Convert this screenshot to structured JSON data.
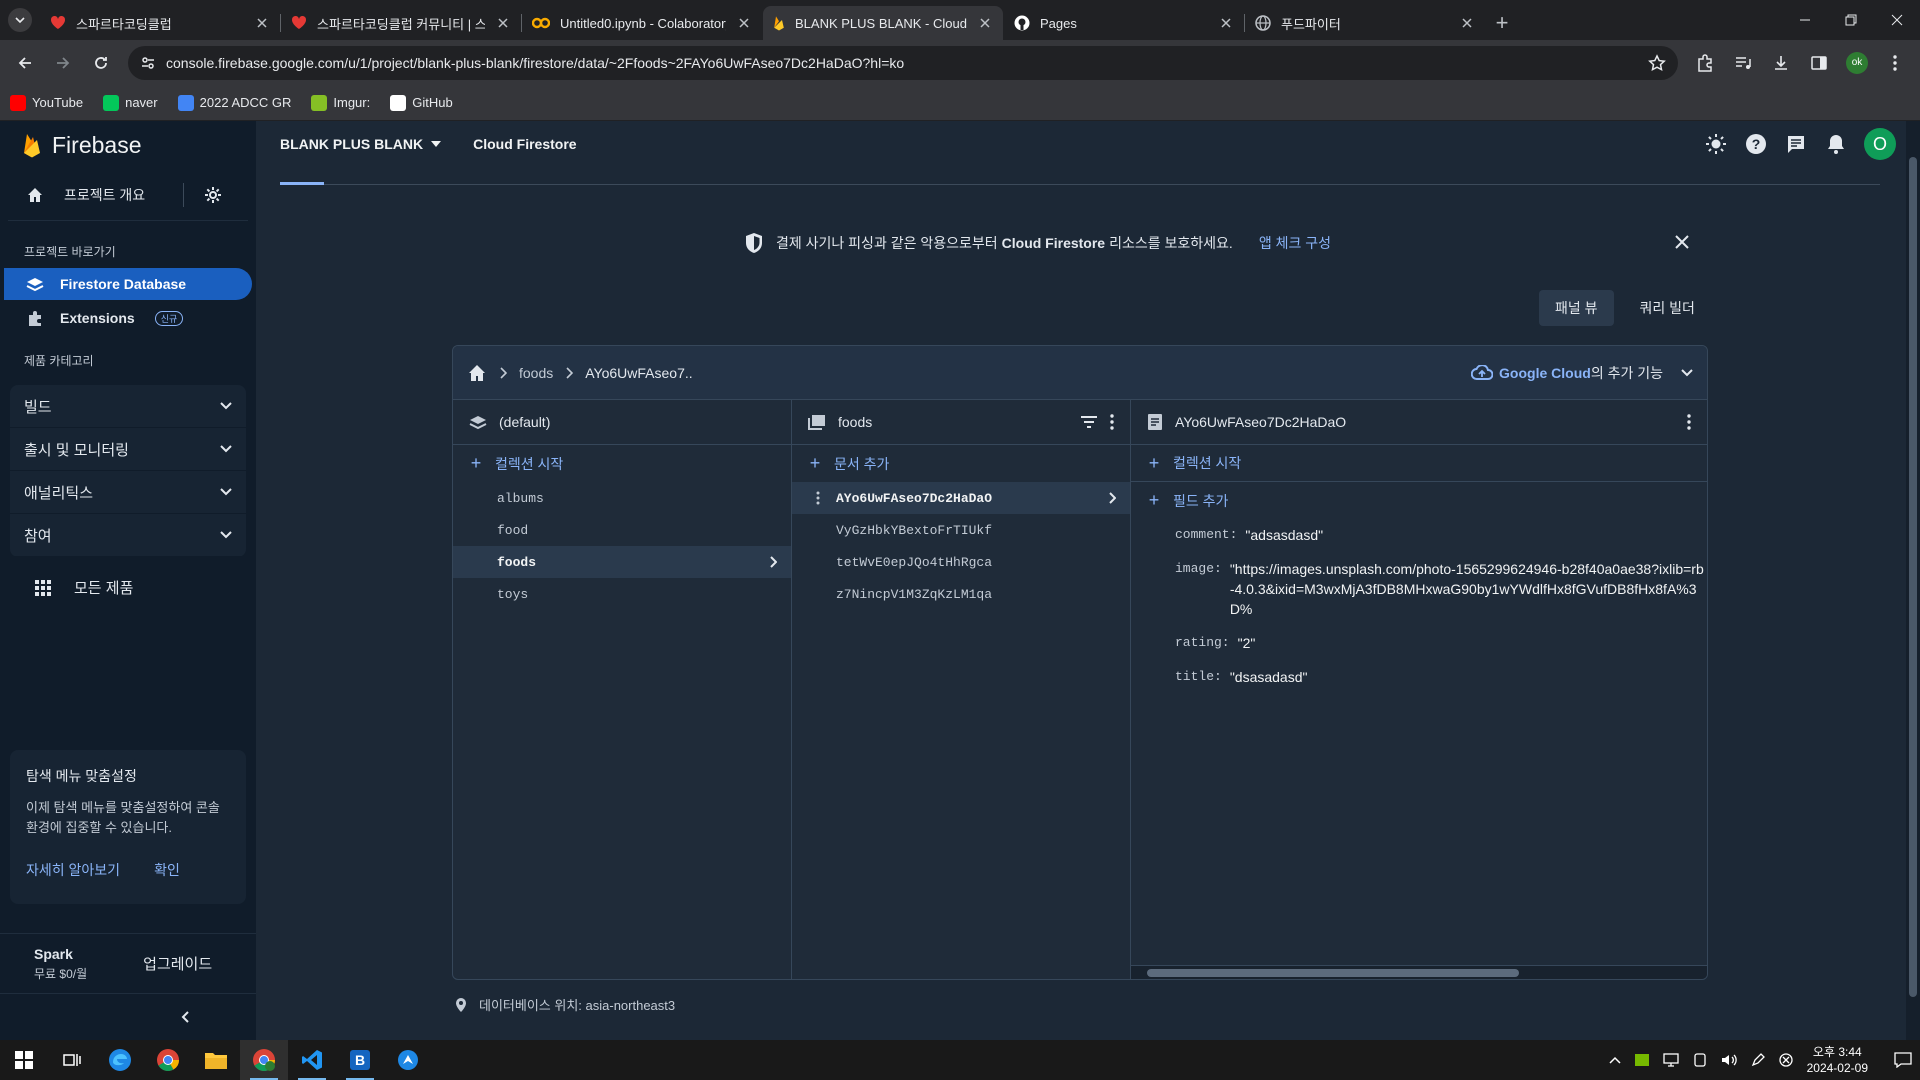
{
  "browser": {
    "tabs": [
      {
        "title": "스파르타코딩클럽",
        "icon": "heart-icon",
        "color": "#e53935"
      },
      {
        "title": "스파르타코딩클럽 커뮤니티 | 스",
        "icon": "heart-icon",
        "color": "#e53935"
      },
      {
        "title": "Untitled0.ipynb - Colaboratory",
        "icon": "colab-icon",
        "color": "#f9ab00"
      },
      {
        "title": "BLANK PLUS BLANK - Cloud Fi",
        "icon": "firebase-icon",
        "color": "#ffca28"
      },
      {
        "title": "Pages",
        "icon": "github-icon",
        "color": "#ffffff"
      },
      {
        "title": "푸드파이터",
        "icon": "globe-icon",
        "color": "#bdc1c6"
      }
    ],
    "active_tab": 3,
    "url": "console.firebase.google.com/u/1/project/blank-plus-blank/firestore/data/~2Ffoods~2FAYo6UwFAseo7Dc2HaDaO?hl=ko",
    "profile_initials": "ok",
    "bookmarks": [
      {
        "label": "YouTube",
        "color": "#ff0000"
      },
      {
        "label": "naver",
        "color": "#03c75a"
      },
      {
        "label": "2022 ADCC GR",
        "color": "#4285f4"
      },
      {
        "label": "Imgur:",
        "color": "#85bf25"
      },
      {
        "label": "GitHub",
        "color": "#ffffff"
      }
    ]
  },
  "firebase": {
    "brand": "Firebase",
    "sidebar": {
      "overview": "프로젝트 개요",
      "shortcuts_label": "프로젝트 바로가기",
      "shortcuts": [
        {
          "label": "Firestore Database",
          "active": true
        },
        {
          "label": "Extensions",
          "badge": "신규",
          "active": false
        }
      ],
      "category_label": "제품 카테고리",
      "categories": [
        "빌드",
        "출시 및 모니터링",
        "애널리틱스",
        "참여"
      ],
      "all_products": "모든 제품",
      "promo": {
        "title": "탐색 메뉴 맞춤설정",
        "body": "이제 탐색 메뉴를 맞춤설정하여 콘솔 환경에 집중할 수 있습니다.",
        "learn_more": "자세히 알아보기",
        "confirm": "확인"
      },
      "plan": {
        "name": "Spark",
        "price": "무료 $0/월",
        "upgrade": "업그레이드"
      }
    },
    "topbar": {
      "project": "BLANK PLUS BLANK",
      "product": "Cloud Firestore",
      "avatar": "O"
    },
    "banner": {
      "text_before": "결제 사기나 피싱과 같은 악용으로부터",
      "text_bold": "Cloud Firestore",
      "text_after": "리소스를 보호하세요.",
      "link": "앱 체크 구성"
    },
    "view_toggle": {
      "panel": "패널 뷰",
      "query": "쿼리 빌더",
      "selected": "panel"
    },
    "breadcrumbs": [
      "foods",
      "AYo6UwFAseo7.."
    ],
    "google_cloud": {
      "bold": "Google Cloud",
      "rest": "의 추가 기능"
    },
    "columns": {
      "root": {
        "title": "(default)",
        "add_label": "컬렉션 시작",
        "items": [
          "albums",
          "food",
          "foods",
          "toys"
        ],
        "selected": 2
      },
      "collection": {
        "title": "foods",
        "add_label": "문서 추가",
        "items": [
          "AYo6UwFAseo7Dc2HaDaO",
          "VyGzHbkYBextoFrTIUkf",
          "tetWvE0epJQo4tHhRgca",
          "z7NincpV1M3ZqKzLM1qa"
        ],
        "selected": 0
      },
      "document": {
        "title": "AYo6UwFAseo7Dc2HaDaO",
        "add_collection_label": "컬렉션 시작",
        "add_field_label": "필드 추가",
        "fields": [
          {
            "key": "comment:",
            "value": "\"adsasdasd\""
          },
          {
            "key": "image:",
            "value": "\"https://images.unsplash.com/photo-1565299624946-b28f40a0ae38?ixlib=rb-4.0.3&ixid=M3wxMjA3fDB8MHxwaG90by1wYWdlfHx8fGVufDB8fHx8fA%3D%"
          },
          {
            "key": "rating:",
            "value": "\"2\""
          },
          {
            "key": "title:",
            "value": "\"dsasadasd\""
          }
        ]
      }
    },
    "db_location": "데이터베이스 위치: asia-northeast3"
  },
  "taskbar": {
    "time": "오후 3:44",
    "date": "2024-02-09"
  }
}
